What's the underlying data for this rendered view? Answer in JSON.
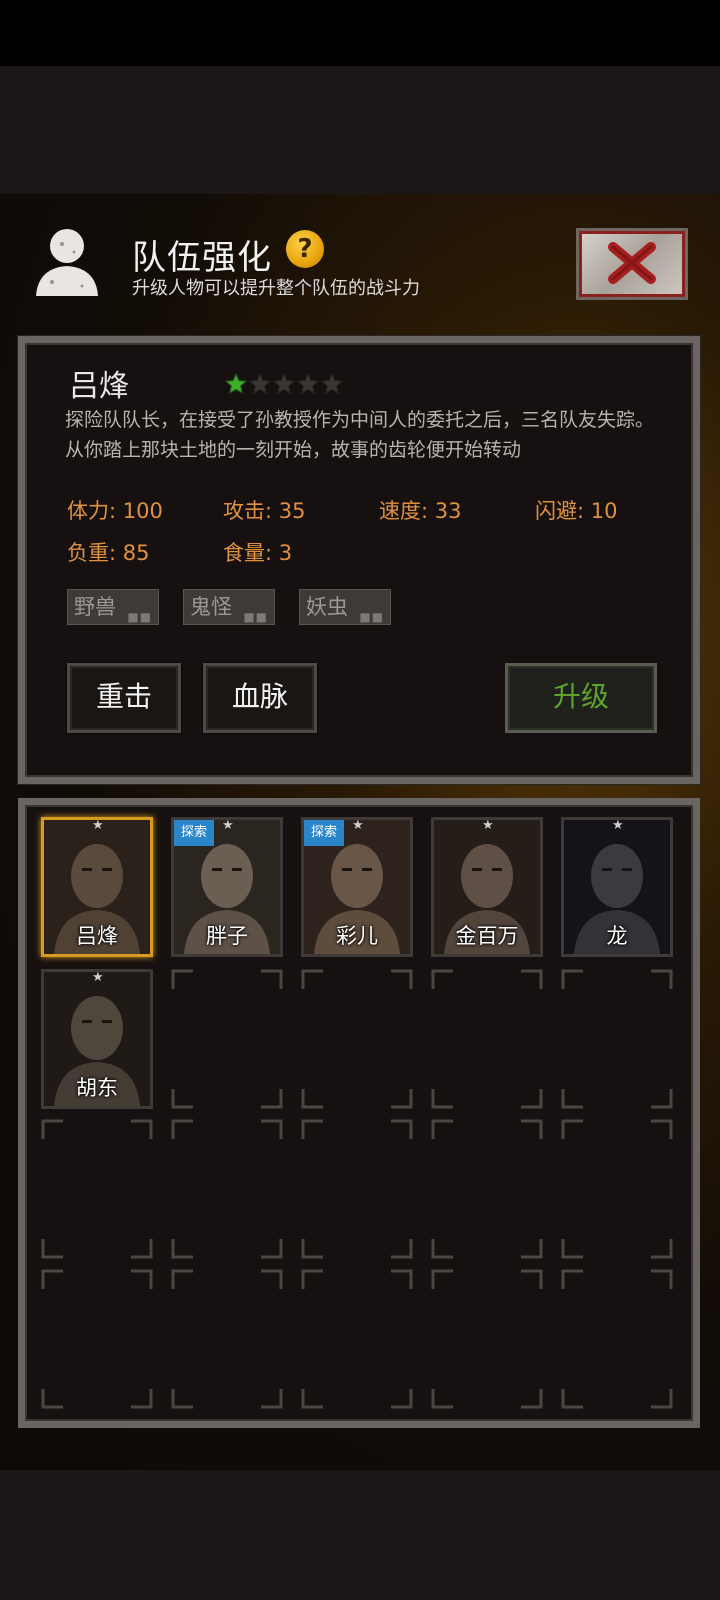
{
  "header": {
    "title": "队伍强化",
    "help_icon": "?",
    "subtitle": "升级人物可以提升整个队伍的战斗力"
  },
  "character": {
    "name": "吕烽",
    "stars_filled": 1,
    "stars_total": 5,
    "description": "探险队队长，在接受了孙教授作为中间人的委托之后，三名队友失踪。从你踏上那块土地的一刻开始，故事的齿轮便开始转动",
    "stats": [
      {
        "label": "体力: 100"
      },
      {
        "label": "攻击: 35"
      },
      {
        "label": "速度: 33"
      },
      {
        "label": "闪避: 10"
      },
      {
        "label": "负重: 85"
      },
      {
        "label": "食量: 3"
      }
    ],
    "tags": [
      {
        "label": "野兽"
      },
      {
        "label": "鬼怪"
      },
      {
        "label": "妖虫"
      }
    ],
    "buttons": {
      "skill1": "重击",
      "skill2": "血脉",
      "upgrade": "升级"
    }
  },
  "roster": [
    {
      "name": "吕烽",
      "badge": "",
      "selected": true
    },
    {
      "name": "胖子",
      "badge": "探索",
      "selected": false
    },
    {
      "name": "彩儿",
      "badge": "探索",
      "selected": false
    },
    {
      "name": "金百万",
      "badge": "",
      "selected": false
    },
    {
      "name": "龙",
      "badge": "",
      "selected": false
    },
    {
      "name": "胡东",
      "badge": "",
      "selected": false
    }
  ],
  "colors": {
    "stat_orange": "#e0913f",
    "upgrade_green": "#5fa42a",
    "star_green": "#3fae2a",
    "selected_border": "#d89a21",
    "badge_blue": "#2a86c9"
  }
}
